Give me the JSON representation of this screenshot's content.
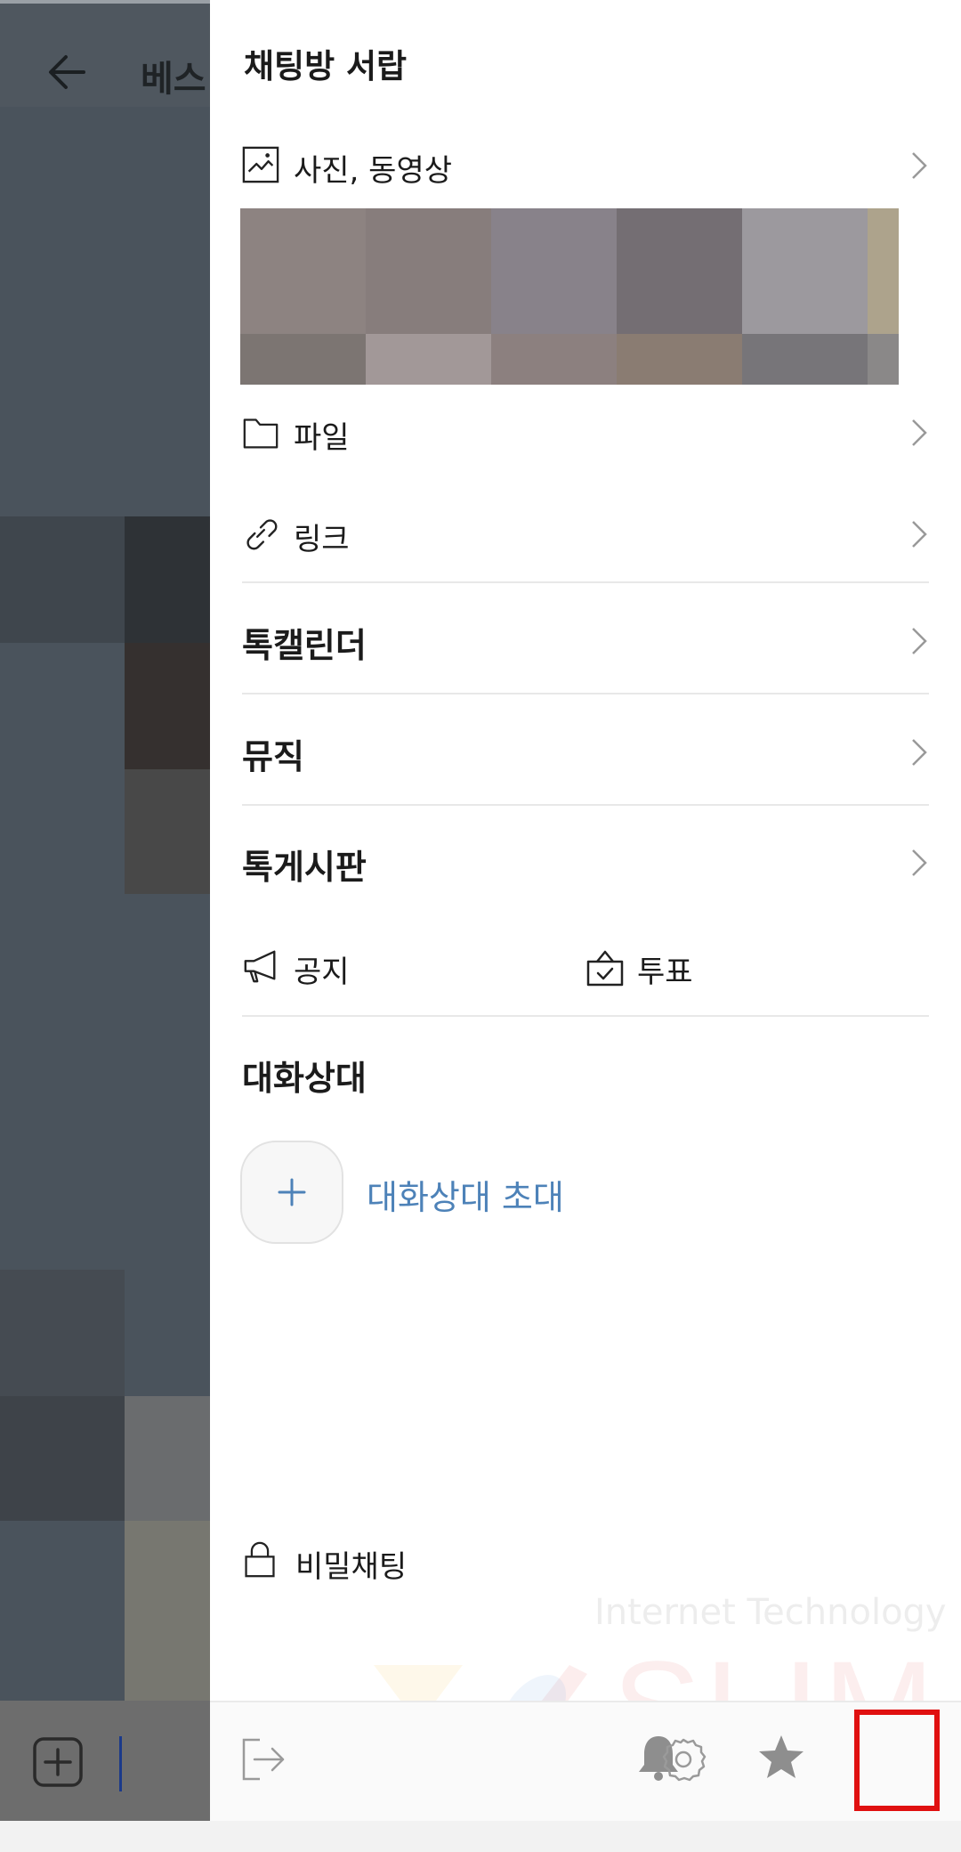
{
  "background_chat": {
    "title": "베스"
  },
  "drawer": {
    "title": "채팅방 서랍",
    "items": {
      "media": {
        "label": "사진, 동영상",
        "icon": "image-icon"
      },
      "file": {
        "label": "파일",
        "icon": "folder-icon"
      },
      "link": {
        "label": "링크",
        "icon": "link-icon"
      },
      "calendar": {
        "label": "톡캘린더"
      },
      "music": {
        "label": "뮤직"
      },
      "board": {
        "label": "톡게시판"
      },
      "notice": {
        "label": "공지",
        "icon": "megaphone-icon"
      },
      "vote": {
        "label": "투표",
        "icon": "ballot-box-icon"
      }
    },
    "members_section": {
      "title": "대화상대",
      "invite_label": "대화상대 초대"
    },
    "secret_chat": {
      "label": "비밀채팅",
      "icon": "lock-icon"
    },
    "bottom_bar": {
      "icons": [
        "exit-icon",
        "bell-icon",
        "star-icon",
        "settings-icon"
      ],
      "highlighted": "settings-icon",
      "highlight_color": "#e01010"
    }
  },
  "watermark": {
    "line1": "Internet Technology",
    "line2": "SLIM"
  },
  "colors": {
    "accent_link": "#4d82b8",
    "highlight": "#e01010"
  }
}
